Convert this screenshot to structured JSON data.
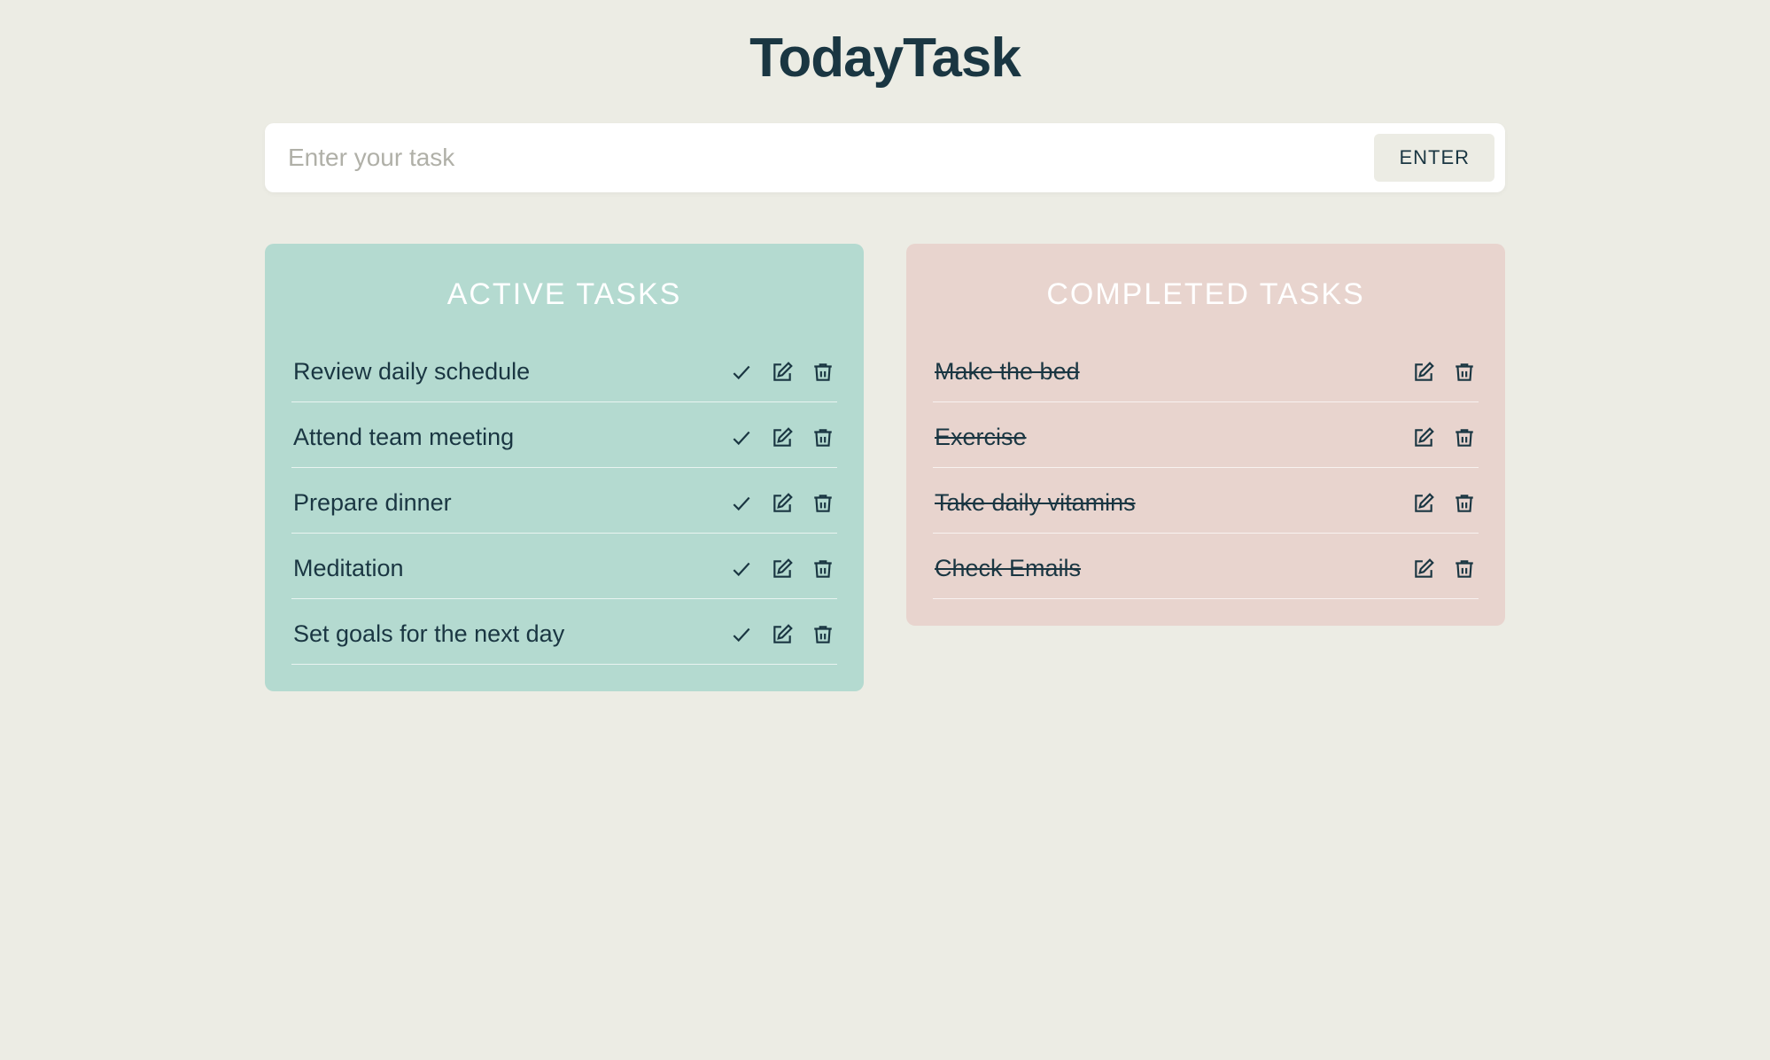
{
  "app": {
    "title": "TodayTask"
  },
  "input": {
    "placeholder": "Enter your task",
    "value": "",
    "button_label": "ENTER"
  },
  "panels": {
    "active": {
      "title": "ACTIVE TASKS",
      "tasks": [
        {
          "text": "Review daily schedule"
        },
        {
          "text": "Attend team meeting"
        },
        {
          "text": "Prepare dinner"
        },
        {
          "text": "Meditation"
        },
        {
          "text": "Set goals for the next day"
        }
      ]
    },
    "completed": {
      "title": "COMPLETED TASKS",
      "tasks": [
        {
          "text": "Make the bed"
        },
        {
          "text": "Exercise"
        },
        {
          "text": "Take daily vitamins"
        },
        {
          "text": "Check Emails"
        }
      ]
    }
  },
  "icons": {
    "check": "check-icon",
    "edit": "edit-icon",
    "trash": "trash-icon"
  },
  "colors": {
    "background": "#ecece4",
    "text_primary": "#1a3642",
    "panel_active": "#b4dad0",
    "panel_completed": "#e8d4ce",
    "panel_title": "#ffffff"
  }
}
